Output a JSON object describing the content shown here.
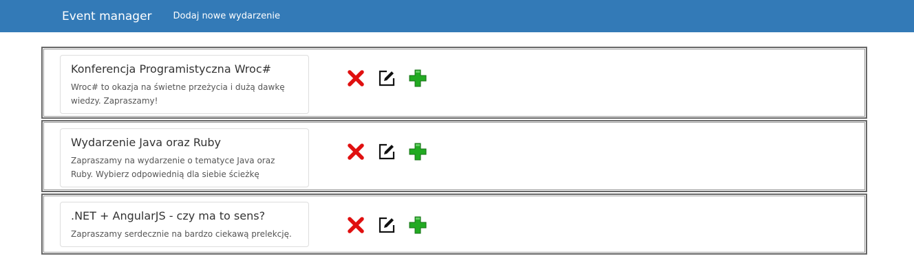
{
  "navbar": {
    "brand": "Event manager",
    "add_link": "Dodaj nowe wydarzenie"
  },
  "events": [
    {
      "title": "Konferencja Programistyczna Wroc#",
      "description": "Wroc# to okazja na świetne przeżycia i dużą dawkę wiedzy. Zapraszamy!"
    },
    {
      "title": "Wydarzenie Java oraz Ruby",
      "description": "Zapraszamy na wydarzenie o tematyce Java oraz Ruby. Wybierz odpowiednią dla siebie ścieżkę"
    },
    {
      "title": ".NET + AngularJS - czy ma to sens?",
      "description": "Zapraszamy serdecznie na bardzo ciekawą prelekcję."
    }
  ],
  "actions": {
    "delete_icon": "x-icon",
    "edit_icon": "edit-icon",
    "add_icon": "plus-icon"
  },
  "colors": {
    "navbar": "#337ab7",
    "delete": "#e01010",
    "add": "#22aa22"
  }
}
